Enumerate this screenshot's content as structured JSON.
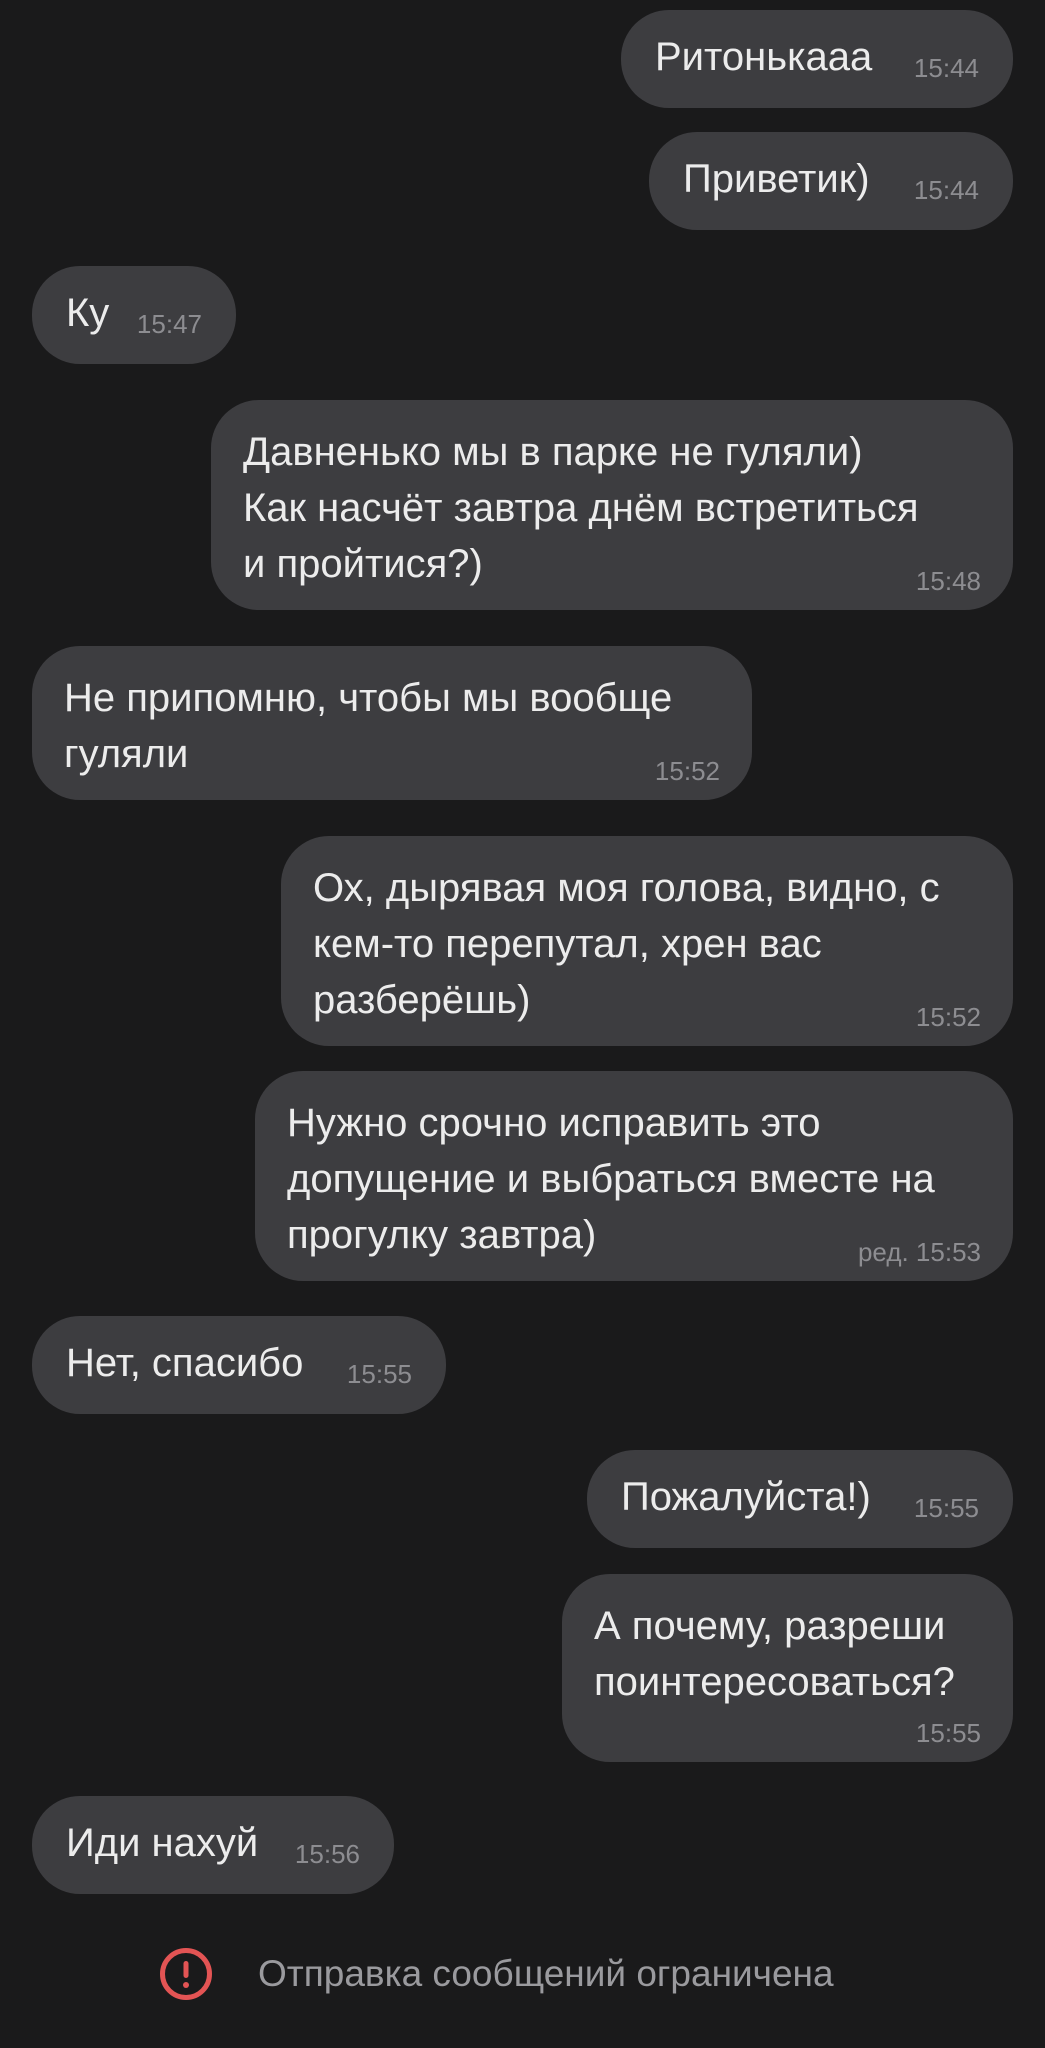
{
  "messages": [
    {
      "side": "out",
      "text": "Ритонькааа",
      "time": "15:44"
    },
    {
      "side": "out",
      "text": "Приветик)",
      "time": "15:44"
    },
    {
      "side": "in",
      "text": "Ку",
      "time": "15:47"
    },
    {
      "side": "out",
      "text": "Давненько мы в парке не гуляли)\nКак насчёт завтра днём встретиться\nи пройтися?)",
      "time": "15:48"
    },
    {
      "side": "in",
      "text": "Не припомню, чтобы мы вообще\nгуляли",
      "time": "15:52"
    },
    {
      "side": "out",
      "text": "Ох, дырявая моя голова, видно, с\nкем-то перепутал, хрен вас\nразберёшь)",
      "time": "15:52"
    },
    {
      "side": "out",
      "text": "Нужно срочно исправить это\nдопущение и выбраться вместе на\nпрогулку завтра)",
      "time": "ред. 15:53"
    },
    {
      "side": "in",
      "text": "Нет, спасибо",
      "time": "15:55"
    },
    {
      "side": "out",
      "text": "Пожалуйста!)",
      "time": "15:55"
    },
    {
      "side": "out",
      "text": "А почему, разреши\nпоинтересоваться?",
      "time": "15:55"
    },
    {
      "side": "in",
      "text": "Иди нахуй",
      "time": "15:56"
    }
  ],
  "footer": {
    "restriction_text": "Отправка сообщений ограничена",
    "icon": "alert-circle-icon",
    "icon_color": "#e35454"
  },
  "colors": {
    "background": "#1a1a1b",
    "bubble": "#3d3d40",
    "timestamp": "#8d8d91"
  }
}
